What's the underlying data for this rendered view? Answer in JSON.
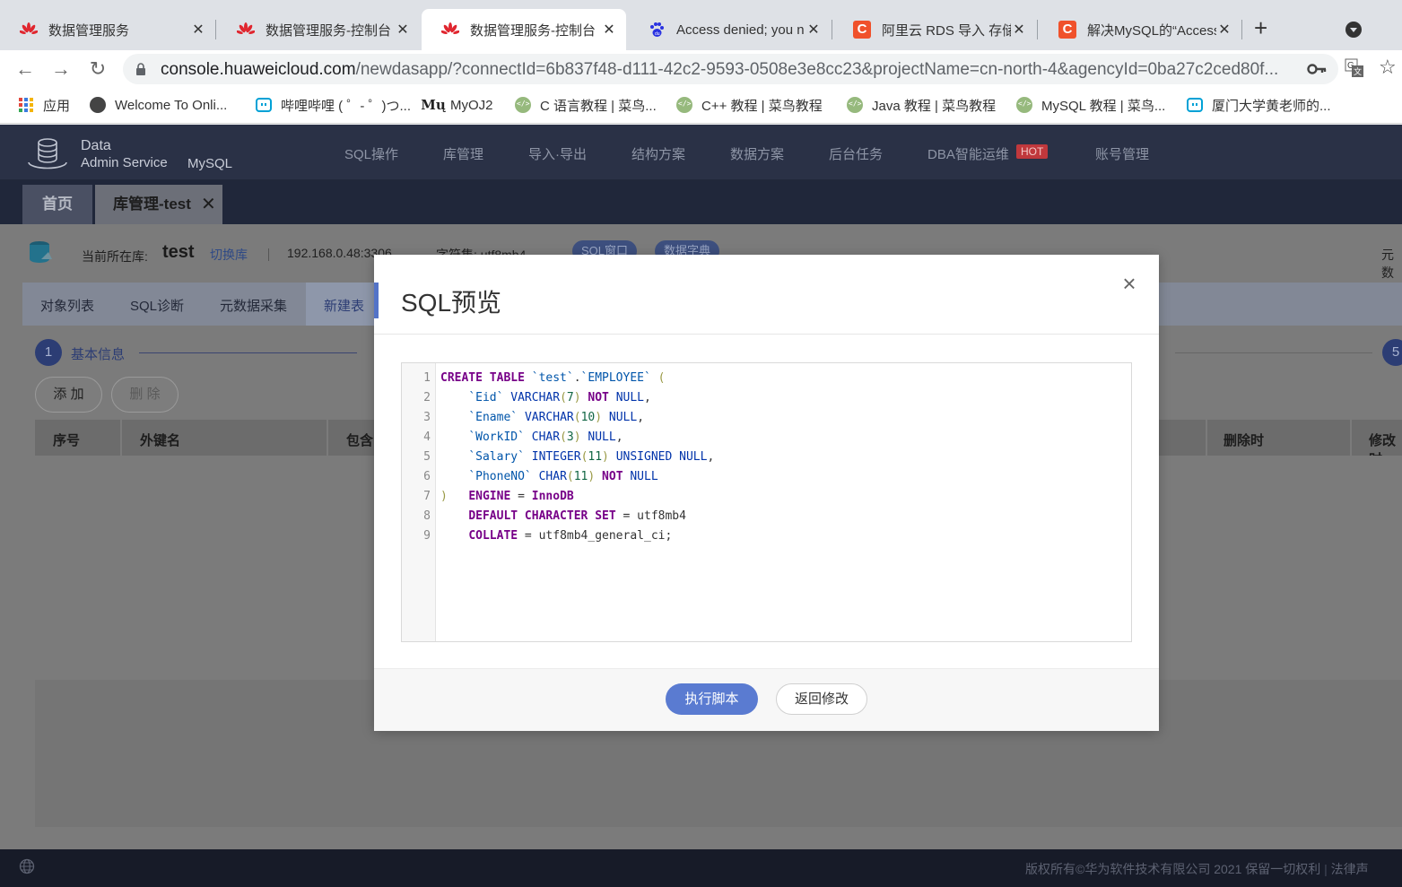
{
  "browser": {
    "tabs": [
      {
        "title": "数据管理服务",
        "favicon": "huawei-logo"
      },
      {
        "title": "数据管理服务-控制台",
        "favicon": "huawei-logo"
      },
      {
        "title": "数据管理服务-控制台",
        "favicon": "huawei-logo",
        "active": true
      },
      {
        "title": "Access denied; you n",
        "favicon": "baidu-paw"
      },
      {
        "title": "阿里云 RDS 导入 存储",
        "favicon": "csdn-c"
      },
      {
        "title": "解决MySQL的“Access",
        "favicon": "csdn-c"
      }
    ],
    "close_glyph": "✕",
    "new_tab_glyph": "+",
    "url_host": "console.huaweicloud.com",
    "url_path": "/newdasapp/?connectId=6b837f48-d111-42c2-9593-0508e3e8cc23&projectName=cn-north-4&agencyId=0ba27c2ced80f...",
    "bookmarks": [
      {
        "label": "应用",
        "icon": "apps-grid-icon"
      },
      {
        "label": "Welcome To Onli...",
        "icon": "globe-icon"
      },
      {
        "label": "哔哩哔哩 ( ゜- ゜)つ...",
        "icon": "bilibili-icon"
      },
      {
        "label": "MyOJ2",
        "icon": "myoj-icon",
        "icon_text": "Mų"
      },
      {
        "label": "C 语言教程 | 菜鸟...",
        "icon": "runoob-icon"
      },
      {
        "label": "C++ 教程 | 菜鸟教程",
        "icon": "runoob-icon"
      },
      {
        "label": "Java 教程 | 菜鸟教程",
        "icon": "runoob-icon"
      },
      {
        "label": "MySQL 教程 | 菜鸟...",
        "icon": "runoob-icon"
      },
      {
        "label": "厦门大学黄老师的...",
        "icon": "bilibili-icon"
      }
    ]
  },
  "app": {
    "logo": {
      "line1": "Data",
      "line2": "Admin Service",
      "engine": "MySQL"
    },
    "nav": [
      "SQL操作",
      "库管理",
      "导入·导出",
      "结构方案",
      "数据方案",
      "后台任务",
      "DBA智能运维",
      "账号管理"
    ],
    "hot_badge": "HOT",
    "page_tabs": {
      "home": "首页",
      "active": "库管理-test"
    },
    "db_bar": {
      "label": "当前所在库:",
      "name": "test",
      "switch": "切换库",
      "ip": "192.168.0.48:3306",
      "charset": "字符集: utf8mb4",
      "sql_window": "SQL窗口",
      "data_dict": "数据字典",
      "right": "元数"
    },
    "subnav": [
      "对象列表",
      "SQL诊断",
      "元数据采集",
      "新建表"
    ],
    "steps": {
      "first_num": "1",
      "first_label": "基本信息",
      "last_num": "5"
    },
    "actions": {
      "add": "添 加",
      "delete": "删 除"
    },
    "table_headers": [
      "序号",
      "外键名",
      "包含",
      "删除时",
      "修改时"
    ],
    "footer": {
      "copyright": "版权所有©华为软件技术有限公司 2021 保留一切权利",
      "legal": "法律声"
    }
  },
  "modal": {
    "title": "SQL预览",
    "close_glyph": "×",
    "line_numbers": [
      "1",
      "2",
      "3",
      "4",
      "5",
      "6",
      "7",
      "8",
      "9"
    ],
    "execute_label": "执行脚本",
    "back_label": "返回修改"
  },
  "colors": {
    "accent": "#5a7bd1",
    "header": "#2a3146",
    "hot": "#c0383c"
  }
}
